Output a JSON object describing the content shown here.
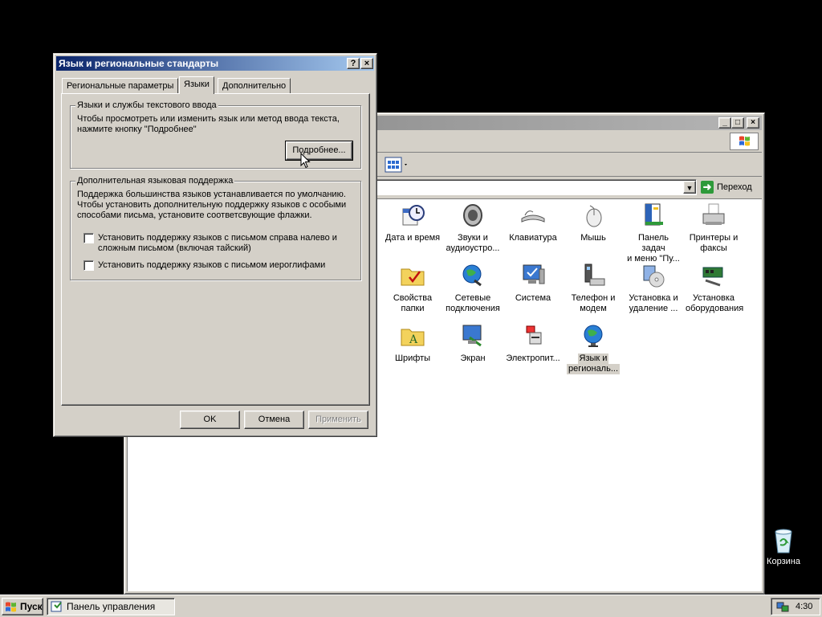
{
  "dialog": {
    "title": "Язык и региональные стандарты",
    "help_btn": "?",
    "close_btn": "×",
    "tabs": [
      {
        "label": "Региональные параметры",
        "active": false
      },
      {
        "label": "Языки",
        "active": true
      },
      {
        "label": "Дополнительно",
        "active": false
      }
    ],
    "group1": {
      "legend": "Языки и службы текстового ввода",
      "text_line1": "Чтобы просмотреть или изменить язык или метод ввода текста,",
      "text_line2": "нажмите кнопку \"Подробнее\"",
      "details_button": "Подробнее..."
    },
    "group2": {
      "legend": "Дополнительная языковая поддержка",
      "text_line1": "Поддержка большинства языков устанавливается по умолчанию.",
      "text_line2": "Чтобы установить дополнительную поддержку языков с особыми",
      "text_line3": "способами письма, установите соответсвующие флажки.",
      "checkbox1_line1": "Установить поддержку языков с письмом справа налево и",
      "checkbox1_line2": "сложным письмом (включая тайский)",
      "checkbox1_checked": false,
      "checkbox2": "Установить поддержку языков с письмом иероглифами",
      "checkbox2_checked": false
    },
    "buttons": {
      "ok": "OK",
      "cancel": "Отмена",
      "apply": "Применить"
    }
  },
  "control_panel": {
    "title_buttons": {
      "minimize": "_",
      "maximize": "□",
      "close": "×"
    },
    "go_button": "Переход",
    "icons": [
      {
        "line1": "Дата и время",
        "line2": "",
        "icon": "clock-calendar-icon"
      },
      {
        "line1": "Звуки и",
        "line2": "аудиоустро...",
        "icon": "speaker-icon"
      },
      {
        "line1": "Клавиатура",
        "line2": "",
        "icon": "keyboard-icon"
      },
      {
        "line1": "Мышь",
        "line2": "",
        "icon": "mouse-icon"
      },
      {
        "line1": "Панель задач",
        "line2": "и меню \"Пу...",
        "icon": "taskbar-icon"
      },
      {
        "line1": "Принтеры и",
        "line2": "факсы",
        "icon": "printer-icon"
      },
      {
        "line1": "Свойства",
        "line2": "папки",
        "icon": "folder-options-icon"
      },
      {
        "line1": "Сетевые",
        "line2": "подключения",
        "icon": "network-icon"
      },
      {
        "line1": "Система",
        "line2": "",
        "icon": "system-icon"
      },
      {
        "line1": "Телефон и",
        "line2": "модем",
        "icon": "phone-modem-icon"
      },
      {
        "line1": "Установка и",
        "line2": "удаление ...",
        "icon": "add-remove-icon"
      },
      {
        "line1": "Установка",
        "line2": "оборудования",
        "icon": "hardware-icon"
      },
      {
        "line1": "Шрифты",
        "line2": "",
        "icon": "fonts-folder-icon"
      },
      {
        "line1": "Экран",
        "line2": "",
        "icon": "display-icon"
      },
      {
        "line1": "Электропит...",
        "line2": "",
        "icon": "power-icon"
      },
      {
        "line1": "Язык и",
        "line2": "региональ...",
        "icon": "globe-icon",
        "selected": true
      }
    ]
  },
  "desktop": {
    "recycle_bin": "Корзина"
  },
  "taskbar": {
    "start": "Пуск",
    "task": "Панель управления",
    "clock": "4:30"
  }
}
